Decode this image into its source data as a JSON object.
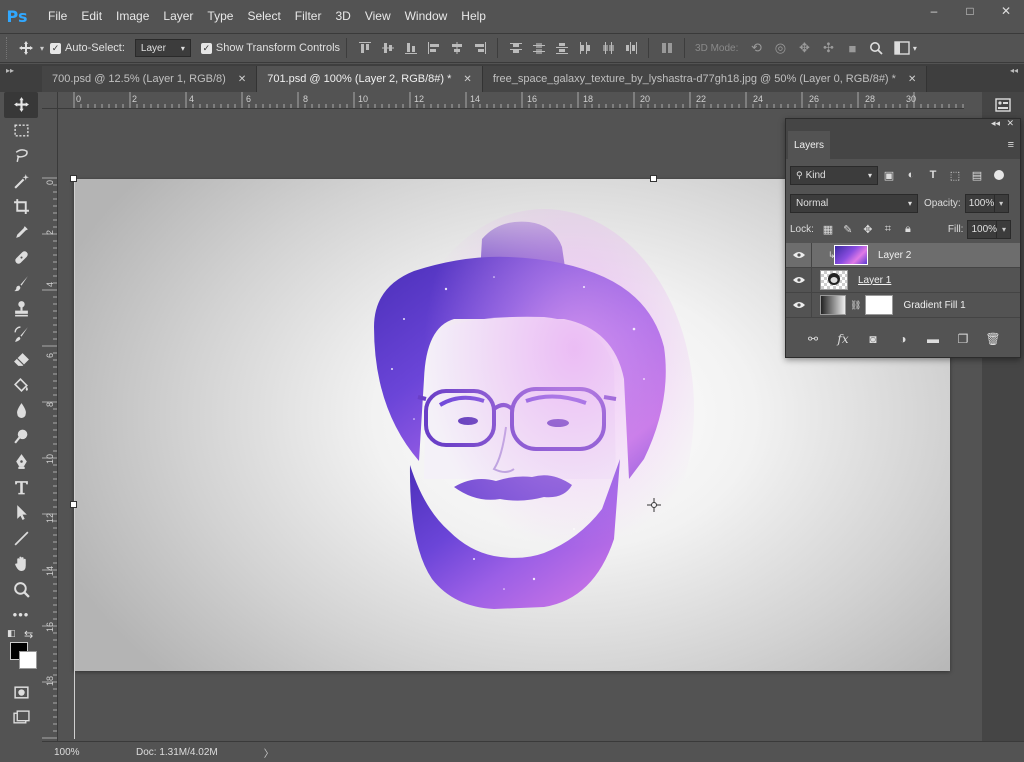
{
  "app": {
    "logo": "Ps"
  },
  "menu": [
    "File",
    "Edit",
    "Image",
    "Layer",
    "Type",
    "Select",
    "Filter",
    "3D",
    "View",
    "Window",
    "Help"
  ],
  "window_controls": {
    "minimize": "‒",
    "maximize": "□",
    "close": "✕"
  },
  "options_bar": {
    "auto_select_label": "Auto-Select:",
    "auto_select_checked": true,
    "auto_select_target": "Layer",
    "show_transform_label": "Show Transform Controls",
    "show_transform_checked": true,
    "three_d_mode_label": "3D Mode:"
  },
  "tabs": [
    {
      "label": "700.psd @ 12.5% (Layer 1, RGB/8)",
      "close": "✕",
      "active": false
    },
    {
      "label": "701.psd @ 100% (Layer 2, RGB/8#) *",
      "close": "✕",
      "active": true
    },
    {
      "label": "free_space_galaxy_texture_by_lyshastra-d77gh18.jpg @ 50% (Layer 0, RGB/8#) *",
      "close": "✕",
      "active": false
    }
  ],
  "ruler_h": [
    "0",
    "2",
    "4",
    "6",
    "8",
    "10",
    "12",
    "14",
    "16",
    "18",
    "20",
    "22",
    "24",
    "26",
    "28",
    "30"
  ],
  "ruler_v": [
    "0",
    "2",
    "4",
    "6",
    "8",
    "10",
    "12",
    "14",
    "16",
    "18"
  ],
  "status": {
    "zoom": "100%",
    "doc": "Doc: 1.31M/4.02M",
    "arrow": "〉"
  },
  "layers_panel": {
    "tab_label": "Layers",
    "kind_label": "Kind",
    "blend_mode": "Normal",
    "opacity_label": "Opacity:",
    "opacity_value": "100%",
    "lock_label": "Lock:",
    "fill_label": "Fill:",
    "fill_value": "100%",
    "layers": [
      {
        "name": "Layer 2",
        "visible": true,
        "active": true,
        "clipped": true
      },
      {
        "name": "Layer 1",
        "visible": true,
        "active": false,
        "clipped": false
      },
      {
        "name": "Gradient Fill 1",
        "visible": true,
        "active": false,
        "clipped": false
      }
    ]
  },
  "colors": {
    "accent_logo": "#31a8ff",
    "foreground": "#000000",
    "background": "#ffffff",
    "galaxy_purple": "#7b4bd6",
    "galaxy_pink": "#d07ae8"
  }
}
